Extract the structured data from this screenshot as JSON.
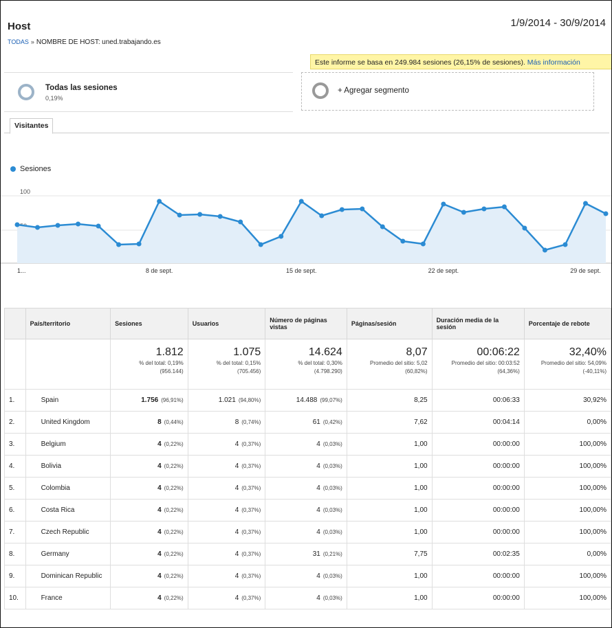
{
  "header": {
    "title": "Host",
    "date_range": "1/9/2014 - 30/9/2014",
    "breadcrumb_root": "TODAS",
    "breadcrumb_sep": "»",
    "breadcrumb_current_label": "NOMBRE DE HOST:",
    "breadcrumb_current_value": "uned.trabajando.es"
  },
  "notice": {
    "text": "Este informe se basa en 249.984 sesiones (26,15% de sesiones).",
    "link": "Más información"
  },
  "segments": {
    "active_label": "Todas las sesiones",
    "active_pct": "0,19%",
    "add_label": "+ Agregar segmento"
  },
  "tabs": {
    "visitors": "Visitantes"
  },
  "chart_data": {
    "type": "line",
    "legend": "Sesiones",
    "y_ticks": [
      "100",
      "50"
    ],
    "ylim": [
      0,
      120
    ],
    "x_tick_labels": [
      "1...",
      "8 de sept.",
      "15 de sept.",
      "22 de sept.",
      "29 de sept."
    ],
    "x_tick_days": [
      1,
      8,
      15,
      22,
      29
    ],
    "days": [
      1,
      2,
      3,
      4,
      5,
      6,
      7,
      8,
      9,
      10,
      11,
      12,
      13,
      14,
      15,
      16,
      17,
      18,
      19,
      20,
      21,
      22,
      23,
      24,
      25,
      26,
      27,
      28,
      29,
      30
    ],
    "values": [
      58,
      54,
      57,
      59,
      56,
      29,
      30,
      92,
      72,
      73,
      70,
      62,
      29,
      41,
      92,
      71,
      80,
      81,
      55,
      34,
      30,
      88,
      76,
      81,
      84,
      53,
      21,
      29,
      89,
      74
    ],
    "color": "#2b8bd3",
    "fill": "#e2eef9"
  },
  "table": {
    "headers": [
      "País/territorio",
      "Sesiones",
      "Usuarios",
      "Número de páginas vistas",
      "Páginas/sesión",
      "Duración media de la sesión",
      "Porcentaje de rebote"
    ],
    "totals": {
      "sessions": "1.812",
      "sessions_sub1": "% del total: 0,19%",
      "sessions_sub2": "(956.144)",
      "users": "1.075",
      "users_sub1": "% del total: 0,15%",
      "users_sub2": "(705.456)",
      "pageviews": "14.624",
      "pageviews_sub1": "% del total: 0,30%",
      "pageviews_sub2": "(4.798.290)",
      "pps": "8,07",
      "pps_sub1": "Promedio del sitio: 5,02",
      "pps_sub2": "(60,82%)",
      "dur": "00:06:22",
      "dur_sub1": "Promedio del sitio: 00:03:52",
      "dur_sub2": "(64,36%)",
      "bounce": "32,40%",
      "bounce_sub1": "Promedio del sitio: 54,09%",
      "bounce_sub2": "(-40,11%)"
    },
    "rows": [
      {
        "rank": "1.",
        "country": "Spain",
        "sessions": "1.756",
        "sessions_pct": "(96,91%)",
        "users": "1.021",
        "users_pct": "(94,80%)",
        "pageviews": "14.488",
        "pageviews_pct": "(99,07%)",
        "pps": "8,25",
        "dur": "00:06:33",
        "bounce": "30,92%"
      },
      {
        "rank": "2.",
        "country": "United Kingdom",
        "sessions": "8",
        "sessions_pct": "(0,44%)",
        "users": "8",
        "users_pct": "(0,74%)",
        "pageviews": "61",
        "pageviews_pct": "(0,42%)",
        "pps": "7,62",
        "dur": "00:04:14",
        "bounce": "0,00%"
      },
      {
        "rank": "3.",
        "country": "Belgium",
        "sessions": "4",
        "sessions_pct": "(0,22%)",
        "users": "4",
        "users_pct": "(0,37%)",
        "pageviews": "4",
        "pageviews_pct": "(0,03%)",
        "pps": "1,00",
        "dur": "00:00:00",
        "bounce": "100,00%"
      },
      {
        "rank": "4.",
        "country": "Bolivia",
        "sessions": "4",
        "sessions_pct": "(0,22%)",
        "users": "4",
        "users_pct": "(0,37%)",
        "pageviews": "4",
        "pageviews_pct": "(0,03%)",
        "pps": "1,00",
        "dur": "00:00:00",
        "bounce": "100,00%"
      },
      {
        "rank": "5.",
        "country": "Colombia",
        "sessions": "4",
        "sessions_pct": "(0,22%)",
        "users": "4",
        "users_pct": "(0,37%)",
        "pageviews": "4",
        "pageviews_pct": "(0,03%)",
        "pps": "1,00",
        "dur": "00:00:00",
        "bounce": "100,00%"
      },
      {
        "rank": "6.",
        "country": "Costa Rica",
        "sessions": "4",
        "sessions_pct": "(0,22%)",
        "users": "4",
        "users_pct": "(0,37%)",
        "pageviews": "4",
        "pageviews_pct": "(0,03%)",
        "pps": "1,00",
        "dur": "00:00:00",
        "bounce": "100,00%"
      },
      {
        "rank": "7.",
        "country": "Czech Republic",
        "sessions": "4",
        "sessions_pct": "(0,22%)",
        "users": "4",
        "users_pct": "(0,37%)",
        "pageviews": "4",
        "pageviews_pct": "(0,03%)",
        "pps": "1,00",
        "dur": "00:00:00",
        "bounce": "100,00%"
      },
      {
        "rank": "8.",
        "country": "Germany",
        "sessions": "4",
        "sessions_pct": "(0,22%)",
        "users": "4",
        "users_pct": "(0,37%)",
        "pageviews": "31",
        "pageviews_pct": "(0,21%)",
        "pps": "7,75",
        "dur": "00:02:35",
        "bounce": "0,00%"
      },
      {
        "rank": "9.",
        "country": "Dominican Republic",
        "sessions": "4",
        "sessions_pct": "(0,22%)",
        "users": "4",
        "users_pct": "(0,37%)",
        "pageviews": "4",
        "pageviews_pct": "(0,03%)",
        "pps": "1,00",
        "dur": "00:00:00",
        "bounce": "100,00%"
      },
      {
        "rank": "10.",
        "country": "France",
        "sessions": "4",
        "sessions_pct": "(0,22%)",
        "users": "4",
        "users_pct": "(0,37%)",
        "pageviews": "4",
        "pageviews_pct": "(0,03%)",
        "pps": "1,00",
        "dur": "00:00:00",
        "bounce": "100,00%"
      }
    ]
  }
}
